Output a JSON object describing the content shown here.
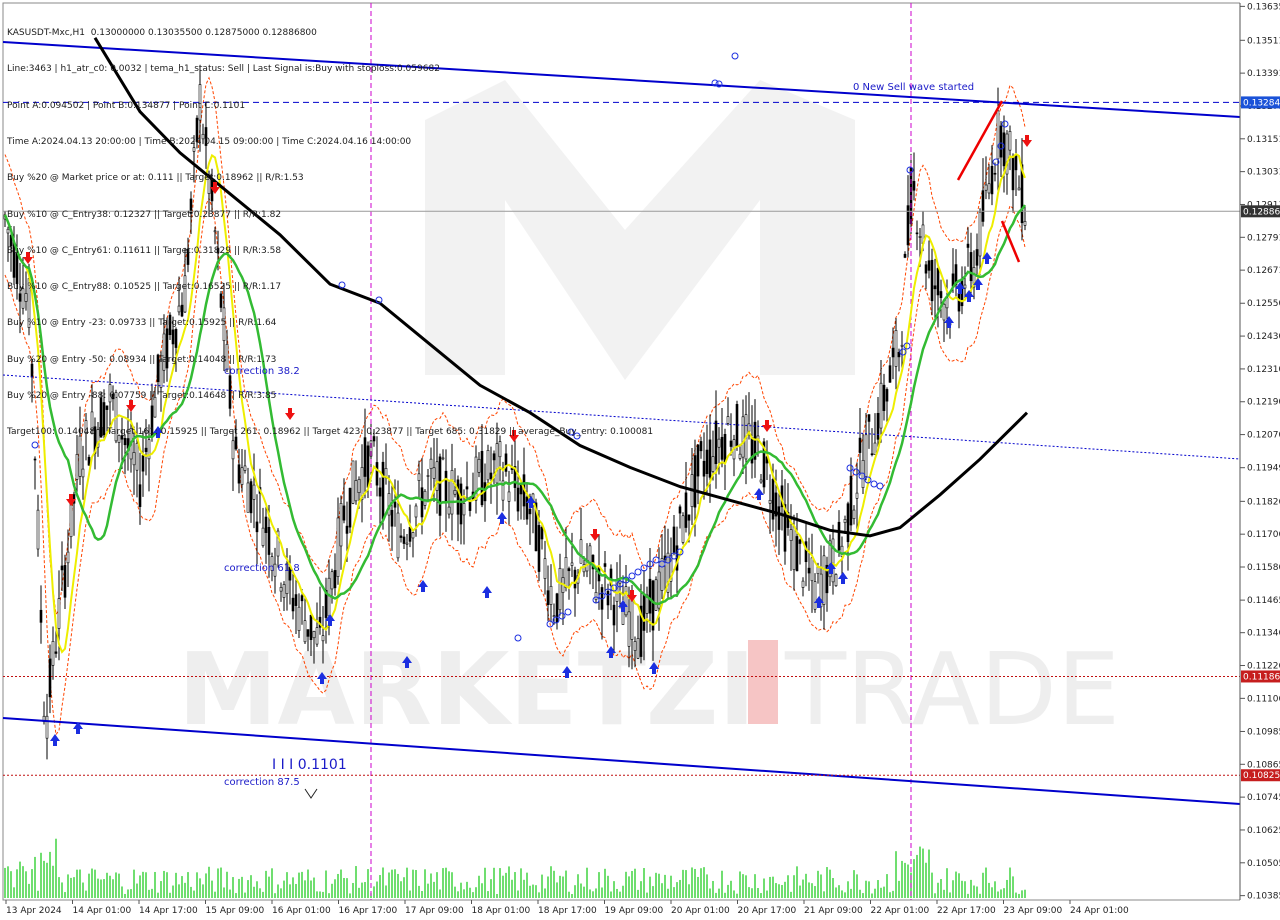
{
  "header": {
    "lines": [
      "KASUSDT-Mxc,H1  0.13000000 0.13035500 0.12875000 0.12886800",
      "Line:3463 | h1_atr_c0: 0.0032 | tema_h1_status: Sell | Last Signal is:Buy with stoploss:0.059682",
      "Point A:0.094502 | Point B:0.134877 | Point C:0.1101",
      "Time A:2024.04.13 20:00:00 | Time B:2024.04.15 09:00:00 | Time C:2024.04.16 14:00:00",
      "Buy %20 @ Market price or at: 0.111 || Target:0.18962 || R/R:1.53",
      "Buy %10 @ C_Entry38: 0.12327 || Target:0.23877 || R/R:1.82",
      "Buy %10 @ C_Entry61: 0.11611 || Target:0.31829 || R/R:3.58",
      "Buy %10 @ C_Entry88: 0.10525 || Target:0.16525 || R/R:1.17",
      "Buy %10 @ Entry -23: 0.09733 || Target:0.15925 || R/R:1.64",
      "Buy %20 @ Entry -50: 0.08934 || Target:0.14048 || R/R:1.73",
      "Buy %20 @ Entry -88: 0.07759 || Target:0.14648 || R/R:3.85",
      "Target100: 0.14048 || Target 161: 0.15925 || Target 261: 0.18962 || Target 423: 0.23877 || Target 685: 0.31829 || average_Buy_entry: 0.100081"
    ]
  },
  "annotations": {
    "new_wave": "0 New Sell wave started",
    "correction_38": "correction 38.2",
    "correction_61": "correction 61.8",
    "correction_87": "correction 87.5",
    "point_c_label": "I I I 0.1101",
    "watermark_bold": "MARKETZI",
    "watermark_light": "TRADE"
  },
  "colors": {
    "grid": "#c8c8c8",
    "trendline": "#0000cc",
    "ema_black": "#000000",
    "ma_green": "#33bb33",
    "ma_yellow": "#eeee00",
    "band_orange": "#ff4500",
    "arrow_buy": "#1b2ee0",
    "arrow_sell": "#ee1111",
    "volume": "#22cc22",
    "tag_blue": "#1a52d8",
    "tag_red": "#c61e1e",
    "tag_gray": "#333333"
  },
  "chart_data": {
    "type": "candlestick",
    "symbol": "KASUSDT-Mxc",
    "timeframe": "H1",
    "ohlc_current": {
      "open": 0.13,
      "high": 0.130355,
      "low": 0.12875,
      "close": 0.128868
    },
    "y_range": [
      0.1038,
      0.1364
    ],
    "y_ticks": [
      "0.13635",
      "0.13511",
      "0.13391",
      "0.13271",
      "0.13151",
      "0.13031",
      "0.12911",
      "0.12791",
      "0.12671",
      "0.12550",
      "0.12430",
      "0.12310",
      "0.12190",
      "0.12070",
      "0.11949",
      "0.11826",
      "0.11706",
      "0.11586",
      "0.11465",
      "0.11346",
      "0.11226",
      "0.11106",
      "0.10985",
      "0.10865",
      "0.10745",
      "0.10625",
      "0.10505",
      "0.10385"
    ],
    "x_ticks": [
      "13 Apr 2024",
      "14 Apr 01:00",
      "14 Apr 17:00",
      "15 Apr 09:00",
      "16 Apr 01:00",
      "16 Apr 17:00",
      "17 Apr 09:00",
      "18 Apr 01:00",
      "18 Apr 17:00",
      "19 Apr 09:00",
      "20 Apr 01:00",
      "20 Apr 17:00",
      "21 Apr 09:00",
      "22 Apr 01:00",
      "22 Apr 17:00",
      "23 Apr 09:00",
      "24 Apr 01:00"
    ],
    "price_tags": [
      {
        "label": "0.13284",
        "value": 0.13284,
        "style": "blue"
      },
      {
        "label": "0.12886",
        "value": 0.12886,
        "style": "gray"
      },
      {
        "label": "0.11186",
        "value": 0.11186,
        "style": "red"
      },
      {
        "label": "0.10825",
        "value": 0.10825,
        "style": "red"
      }
    ],
    "levels": [
      {
        "value": 0.13284,
        "style": "dashed-blue"
      },
      {
        "value": 0.12886,
        "style": "solid-gray"
      },
      {
        "value": 0.11186,
        "style": "dotted-red"
      },
      {
        "value": 0.10825,
        "style": "dotted-red"
      }
    ],
    "points": {
      "A": 0.094502,
      "B": 0.134877,
      "C": 0.1101
    }
  }
}
